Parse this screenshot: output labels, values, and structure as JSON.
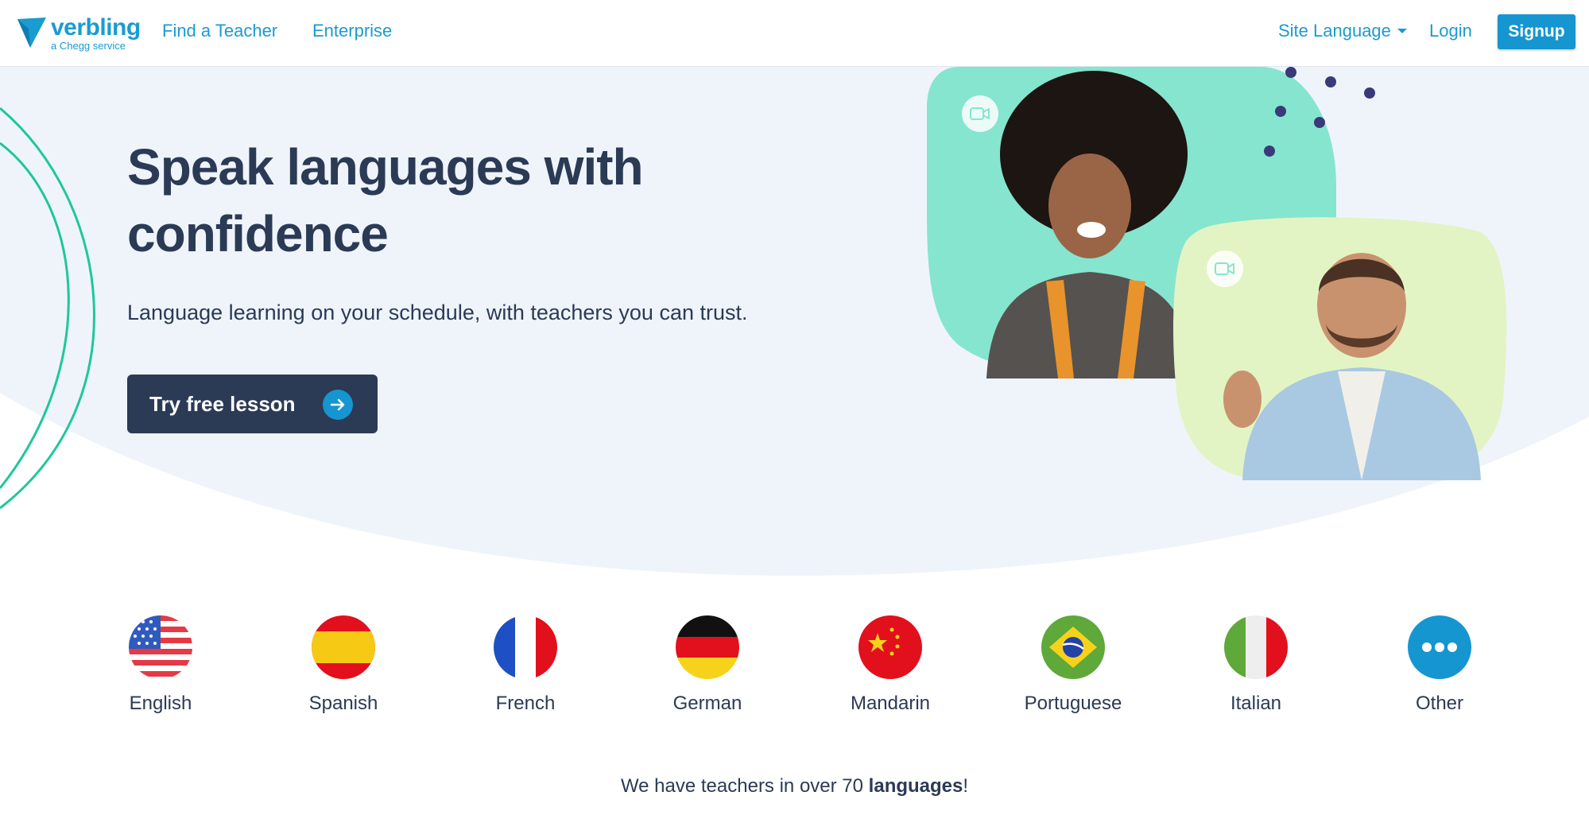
{
  "header": {
    "logo_word": "verbling",
    "logo_sub": "a Chegg service",
    "nav_find": "Find a Teacher",
    "nav_enterprise": "Enterprise",
    "site_language": "Site Language",
    "login": "Login",
    "signup": "Signup"
  },
  "hero": {
    "title": "Speak languages with confidence",
    "subtitle": "Language learning on your schedule, with teachers you can trust.",
    "cta_label": "Try free lesson"
  },
  "languages": [
    {
      "label": "English",
      "icon": "us-flag-icon"
    },
    {
      "label": "Spanish",
      "icon": "spain-flag-icon"
    },
    {
      "label": "French",
      "icon": "france-flag-icon"
    },
    {
      "label": "German",
      "icon": "germany-flag-icon"
    },
    {
      "label": "Mandarin",
      "icon": "china-flag-icon"
    },
    {
      "label": "Portuguese",
      "icon": "brazil-flag-icon"
    },
    {
      "label": "Italian",
      "icon": "italy-flag-icon"
    },
    {
      "label": "Other",
      "icon": "more-icon"
    }
  ],
  "footer": {
    "prefix": "We have teachers in over 70 ",
    "bold": "languages",
    "suffix": "!"
  },
  "colors": {
    "brand_blue": "#1596d0",
    "navy": "#2b3a55",
    "hero_bg": "#eff4fb",
    "mint": "#86e5cf",
    "lime": "#e3f4c4",
    "ring": "#1fc79a"
  }
}
